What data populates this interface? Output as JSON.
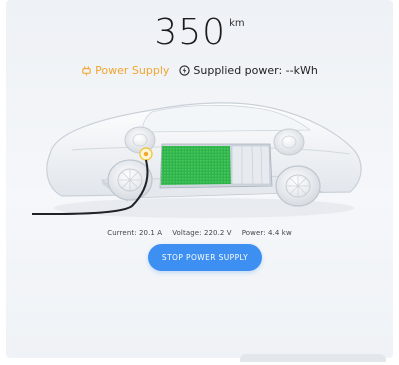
{
  "range": {
    "value": "350",
    "unit": "km"
  },
  "status": {
    "supply_label": "Power Supply",
    "supplied_label": "Supplied power: --kWh"
  },
  "readings": {
    "current": "Current: 20.1 A",
    "voltage": "Voltage: 220.2 V",
    "power": "Power: 4.4 kw"
  },
  "actions": {
    "stop_label": "STOP POWER SUPPLY"
  },
  "icons": {
    "supply": "plug-icon",
    "supplied": "power-icon"
  },
  "colors": {
    "accent": "#3d8ff2",
    "supply_status": "#f0a630",
    "battery": "#2fb34a"
  }
}
